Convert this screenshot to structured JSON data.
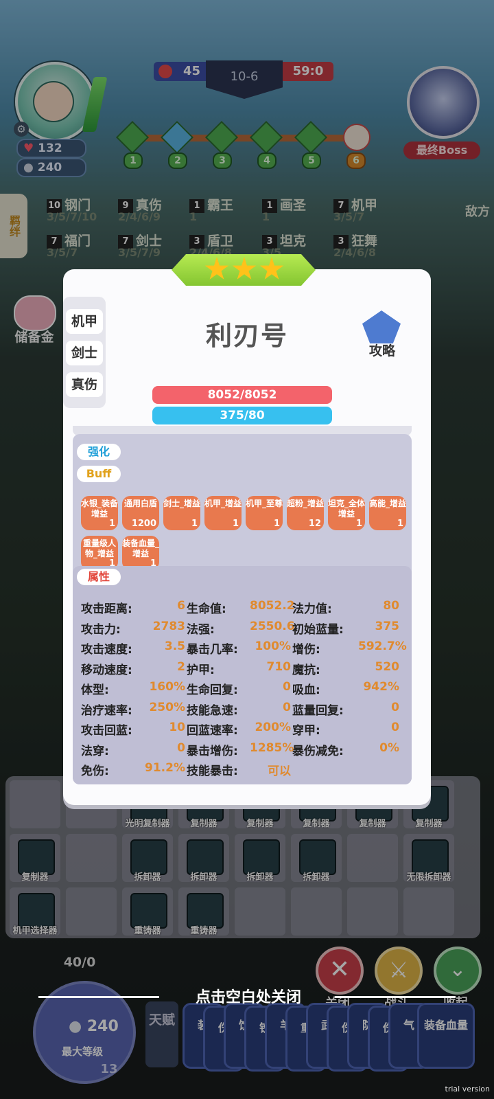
{
  "player": {
    "hp": "132",
    "coins": "240"
  },
  "score": {
    "left": "45",
    "middle": "10-6",
    "right": "59:0"
  },
  "stages": [
    "1",
    "2",
    "3",
    "4",
    "5",
    "6"
  ],
  "boss_label": "最终Boss",
  "side_tab_label": "羁绊",
  "enemy_tab_label": "敌方",
  "synergies": [
    {
      "count": "10",
      "name": "钢门",
      "sub": "3/5/7/10"
    },
    {
      "count": "9",
      "name": "真伤",
      "sub": "2/4/6/9"
    },
    {
      "count": "1",
      "name": "霸王",
      "sub": "1"
    },
    {
      "count": "1",
      "name": "画圣",
      "sub": "1"
    },
    {
      "count": "7",
      "name": "机甲",
      "sub": "3/5/7"
    },
    {
      "count": "7",
      "name": "福门",
      "sub": "3/5/7"
    },
    {
      "count": "7",
      "name": "剑士",
      "sub": "3/5/7/9"
    },
    {
      "count": "3",
      "name": "盾卫",
      "sub": "2/4/6/8"
    },
    {
      "count": "3",
      "name": "坦克",
      "sub": "3/5"
    },
    {
      "count": "3",
      "name": "狂舞",
      "sub": "2/4/6/8"
    }
  ],
  "savings_label": "储备金",
  "modal": {
    "tabs": [
      "机甲",
      "剑士",
      "真伤"
    ],
    "unit_name": "利刃号",
    "guide_label": "攻略",
    "stars": 3,
    "hp": "8052/8052",
    "mp": "375/80",
    "enhance_label": "强化",
    "buff_label": "Buff",
    "buffs": [
      {
        "name": "水银_装备增益",
        "count": "1"
      },
      {
        "name": "通用白盾",
        "count": "1200"
      },
      {
        "name": "剑士_增益",
        "count": "1"
      },
      {
        "name": "机甲_增益",
        "count": "1"
      },
      {
        "name": "机甲_至尊",
        "count": "1"
      },
      {
        "name": "超粉_增益",
        "count": "12"
      },
      {
        "name": "坦克_全体增益",
        "count": "1"
      },
      {
        "name": "高能_增益",
        "count": "1"
      },
      {
        "name": "重量级人物_增益",
        "count": "1"
      },
      {
        "name": "装备血量_增益",
        "count": "1"
      }
    ],
    "attr_label": "属性",
    "attributes": [
      [
        {
          "label": "攻击距离:",
          "value": "6"
        },
        {
          "label": "生命值:",
          "value": "8052.2"
        },
        {
          "label": "法力值:",
          "value": "80"
        }
      ],
      [
        {
          "label": "攻击力:",
          "value": "2783"
        },
        {
          "label": "法强:",
          "value": "2550.6"
        },
        {
          "label": "初始蓝量:",
          "value": "375"
        }
      ],
      [
        {
          "label": "攻击速度:",
          "value": "3.5"
        },
        {
          "label": "暴击几率:",
          "value": "100%"
        },
        {
          "label": "增伤:",
          "value": "592.7%"
        }
      ],
      [
        {
          "label": "移动速度:",
          "value": "2"
        },
        {
          "label": "护甲:",
          "value": "710"
        },
        {
          "label": "魔抗:",
          "value": "520"
        }
      ],
      [
        {
          "label": "体型:",
          "value": "160%"
        },
        {
          "label": "生命回复:",
          "value": "0"
        },
        {
          "label": "吸血:",
          "value": "942%"
        }
      ],
      [
        {
          "label": "治疗速率:",
          "value": "250%"
        },
        {
          "label": "技能急速:",
          "value": "0"
        },
        {
          "label": "蓝量回复:",
          "value": "0"
        }
      ],
      [
        {
          "label": "攻击回蓝:",
          "value": "10"
        },
        {
          "label": "回蓝速率:",
          "value": "200%"
        },
        {
          "label": "穿甲:",
          "value": "0"
        }
      ],
      [
        {
          "label": "法穿:",
          "value": "0"
        },
        {
          "label": "暴击增伤:",
          "value": "1285%"
        },
        {
          "label": "暴伤减免:",
          "value": "0%"
        }
      ],
      [
        {
          "label": "免伤:",
          "value": "91.2%"
        },
        {
          "label": "技能暴击:",
          "value": "可以"
        },
        {
          "label": "",
          "value": ""
        }
      ]
    ]
  },
  "inventory": {
    "row1": [
      "",
      "",
      "光明复制器",
      "复制器",
      "复制器",
      "复制器",
      "复制器",
      "复制器"
    ],
    "row2": [
      "复制器",
      "",
      "拆卸器",
      "拆卸器",
      "拆卸器",
      "拆卸器",
      "",
      "无限拆卸器"
    ],
    "row3": [
      "机甲选择器",
      "",
      "重铸器",
      "重铸器",
      "",
      "",
      "",
      ""
    ]
  },
  "actions": {
    "close": "关闭",
    "battle": "战斗",
    "collapse": "收起"
  },
  "close_hint": "点击空白处关闭",
  "level": {
    "progress": "40/0",
    "coins": "240",
    "label": "最大等级",
    "num": "13"
  },
  "talent_label": "天赋",
  "bottom_cards": [
    "装",
    "伤",
    "饮",
    "铁",
    "羊",
    "重",
    "武",
    "伤",
    "防",
    "伤",
    "气"
  ],
  "last_card": "装备血量",
  "trial": "trial version",
  "colors": {
    "hp_bar": "#f3636b",
    "mp_bar": "#37c0ef",
    "buff": "#e8794e",
    "value_text": "#e08a2e"
  }
}
